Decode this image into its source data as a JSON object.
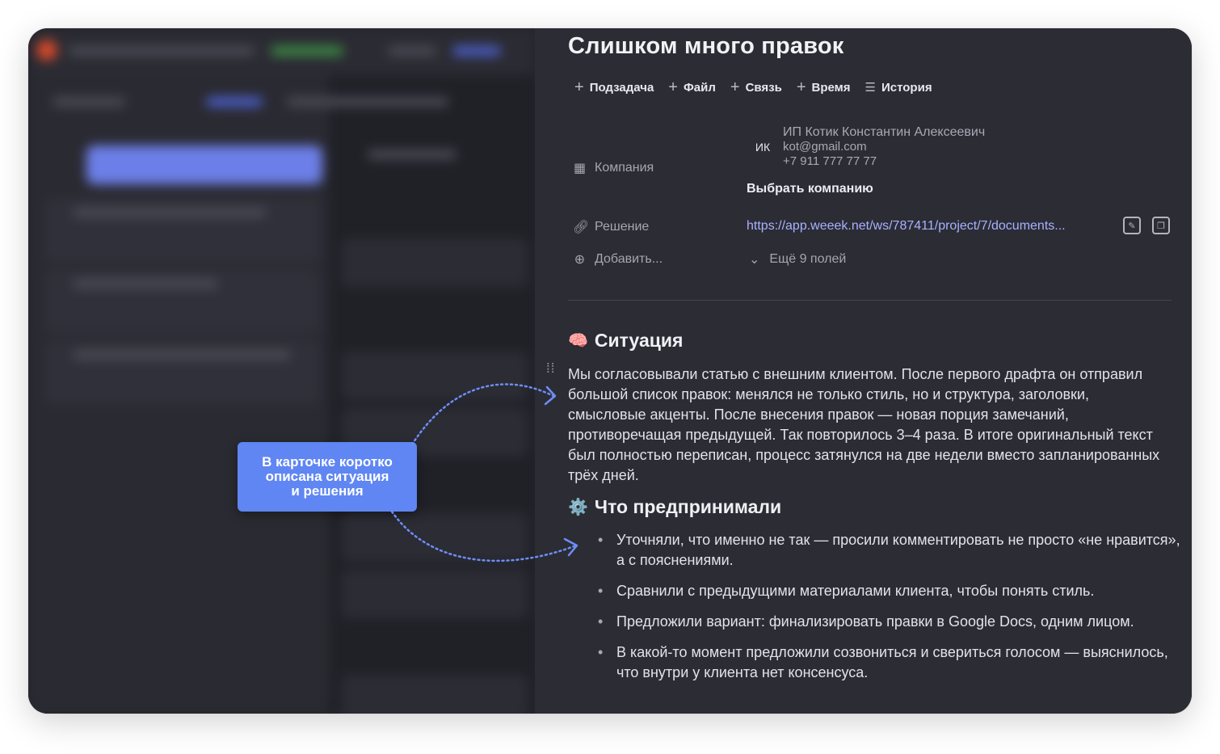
{
  "background_app": {
    "note_blurred": true
  },
  "callout": {
    "text": "В карточке коротко\nописана ситуация\nи решения"
  },
  "task": {
    "title": "Слишком много правок",
    "toolbar": [
      {
        "icon": "plus-icon",
        "label": "Подзадача"
      },
      {
        "icon": "plus-icon",
        "label": "Файл"
      },
      {
        "icon": "plus-icon",
        "label": "Связь"
      },
      {
        "icon": "plus-icon",
        "label": "Время"
      },
      {
        "icon": "list-icon",
        "label": "История"
      }
    ],
    "fields": {
      "company_label": "Компания",
      "company_avatar": "ИК",
      "company_name": "ИП Котик Константин Алексеевич",
      "company_email": "kot@gmail.com",
      "company_phone": "+7 911 777 77 77",
      "choose_company": "Выбрать компанию",
      "solution_label": "Решение",
      "solution_link": "https://app.weeek.net/ws/787411/project/7/documents...",
      "add_label": "Добавить...",
      "more_fields": "Ещё 9 полей"
    },
    "situation": {
      "emoji": "🧠",
      "heading": "Ситуация",
      "text": "Мы согласовывали статью с внешним клиентом. После первого драфта он отправил большой список правок: менялся не только стиль, но и структура, заголовки, смысловые акценты. После внесения правок — новая порция замечаний, противоречащая предыдущей. Так повторилось 3–4 раза. В итоге оригинальный текст был полностью переписан, процесс затянулся на две недели вместо запланированных трёх дней."
    },
    "actions": {
      "emoji": "⚙️",
      "heading": "Что предпринимали",
      "items": [
        "Уточняли, что именно не так — просили комментировать не просто «не нравится», а с пояснениями.",
        "Сравнили с предыдущими материалами клиента, чтобы понять стиль.",
        "Предложили вариант: финализировать правки в Google Docs, одним лицом.",
        "В какой-то момент предложили созвониться и свериться голосом — выяснилось, что внутри у клиента нет консенсуса."
      ]
    }
  },
  "colors": {
    "accent": "#5f86f2",
    "link": "#a8b2ff",
    "panel_bg": "#2c2c35"
  }
}
